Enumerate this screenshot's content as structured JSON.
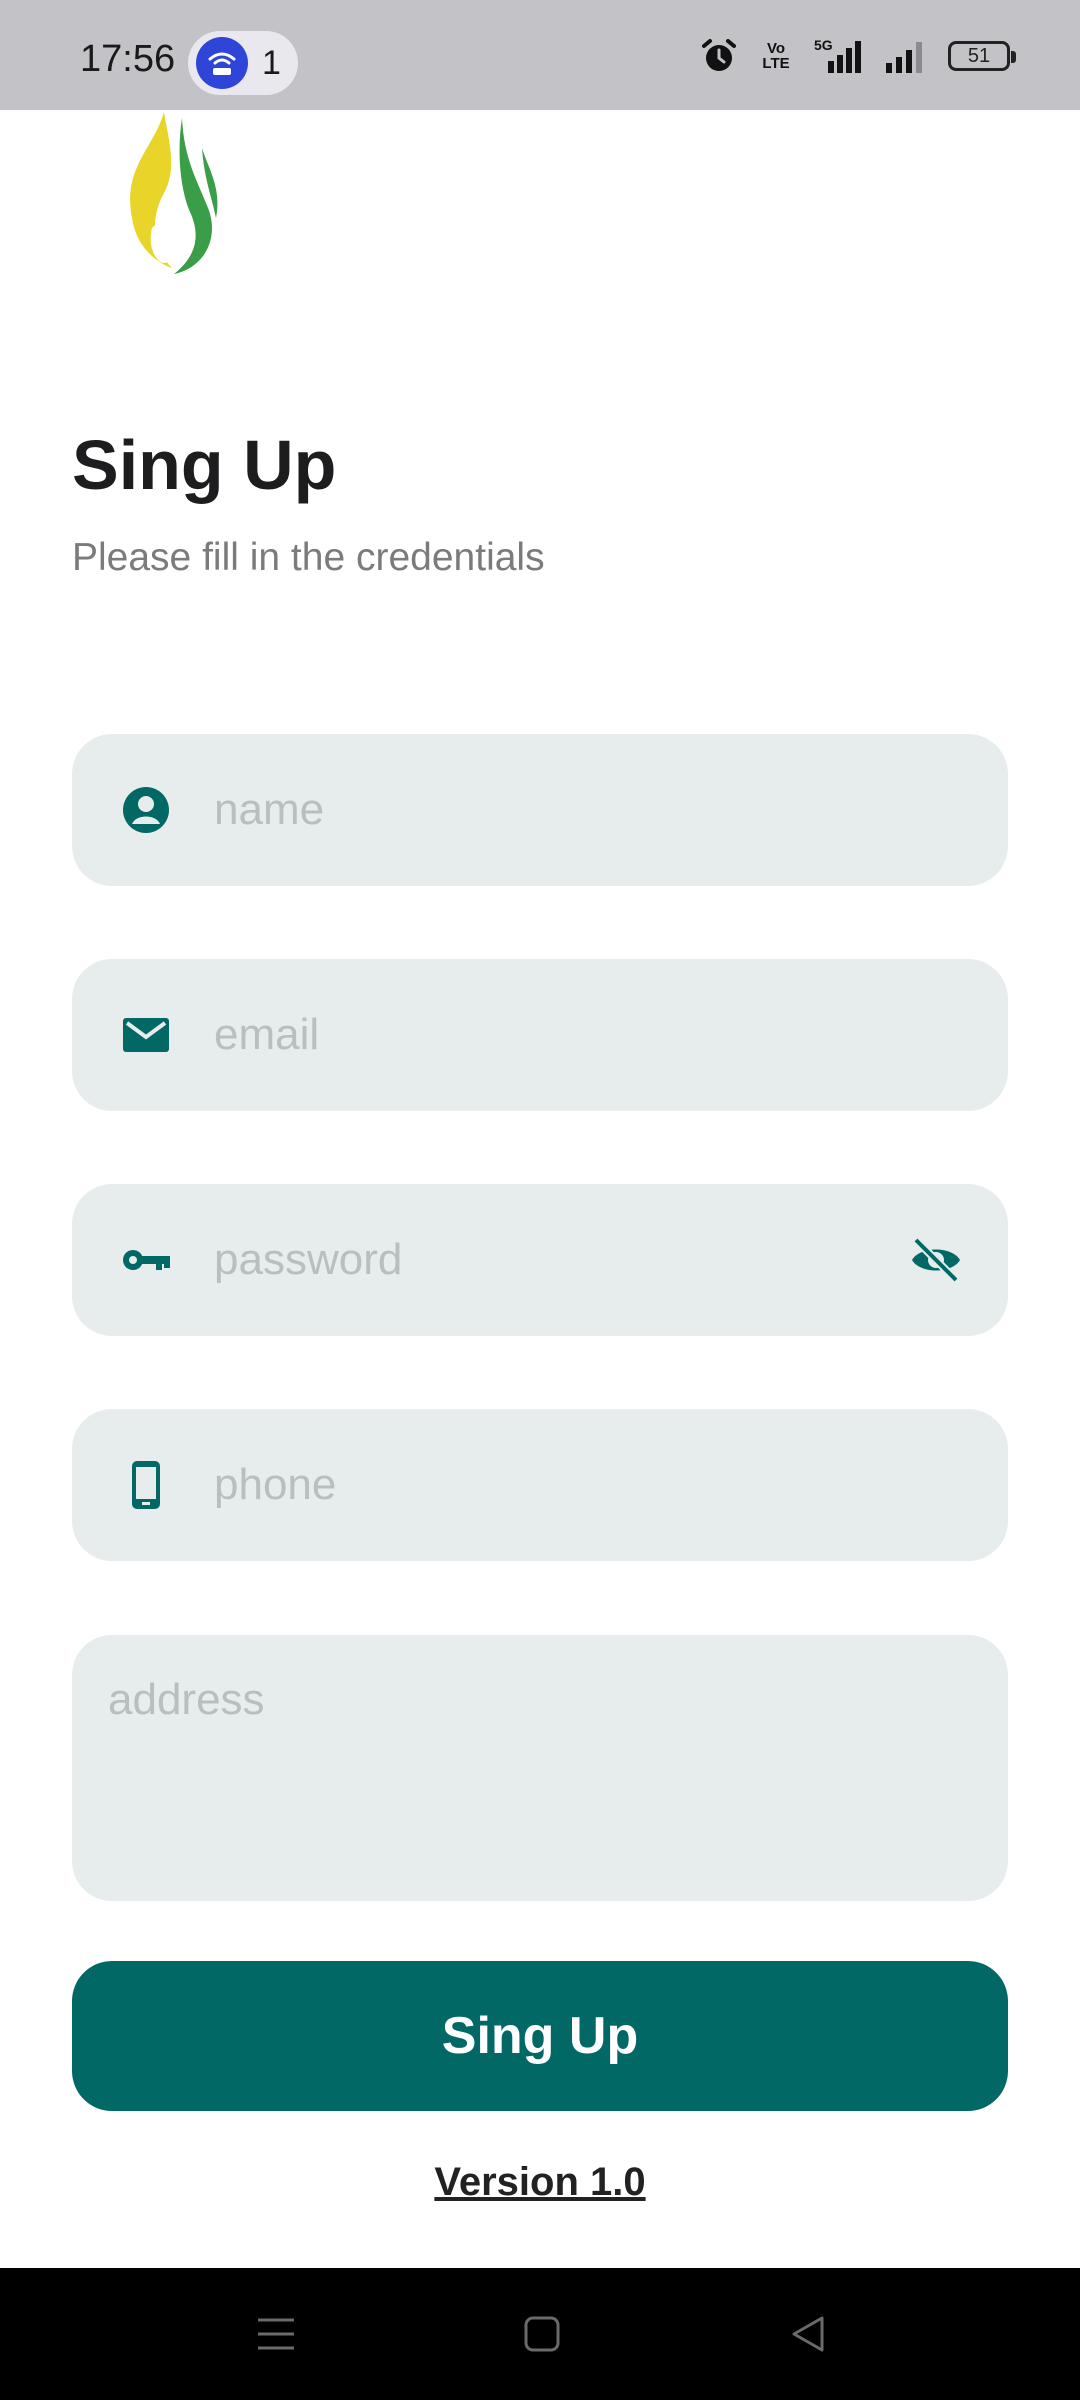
{
  "status_bar": {
    "time": "17:56",
    "hotspot_count": "1",
    "network_label": "5G",
    "volte_top": "Vo",
    "volte_bottom": "LTE",
    "battery": "51"
  },
  "header": {
    "title": "Sing Up",
    "subtitle": "Please fill in the credentials"
  },
  "form": {
    "name_placeholder": "name",
    "email_placeholder": "email",
    "password_placeholder": "password",
    "phone_placeholder": "phone",
    "address_placeholder": "address",
    "submit_label": "Sing Up"
  },
  "footer": {
    "version": "Version 1.0"
  },
  "colors": {
    "primary": "#026866",
    "field_bg": "#e7eced",
    "status_bar_bg": "#c3c2c6"
  },
  "icons": [
    "person-icon",
    "mail-icon",
    "key-icon",
    "eye-off-icon",
    "phone-device-icon",
    "logo-flame-icon"
  ]
}
